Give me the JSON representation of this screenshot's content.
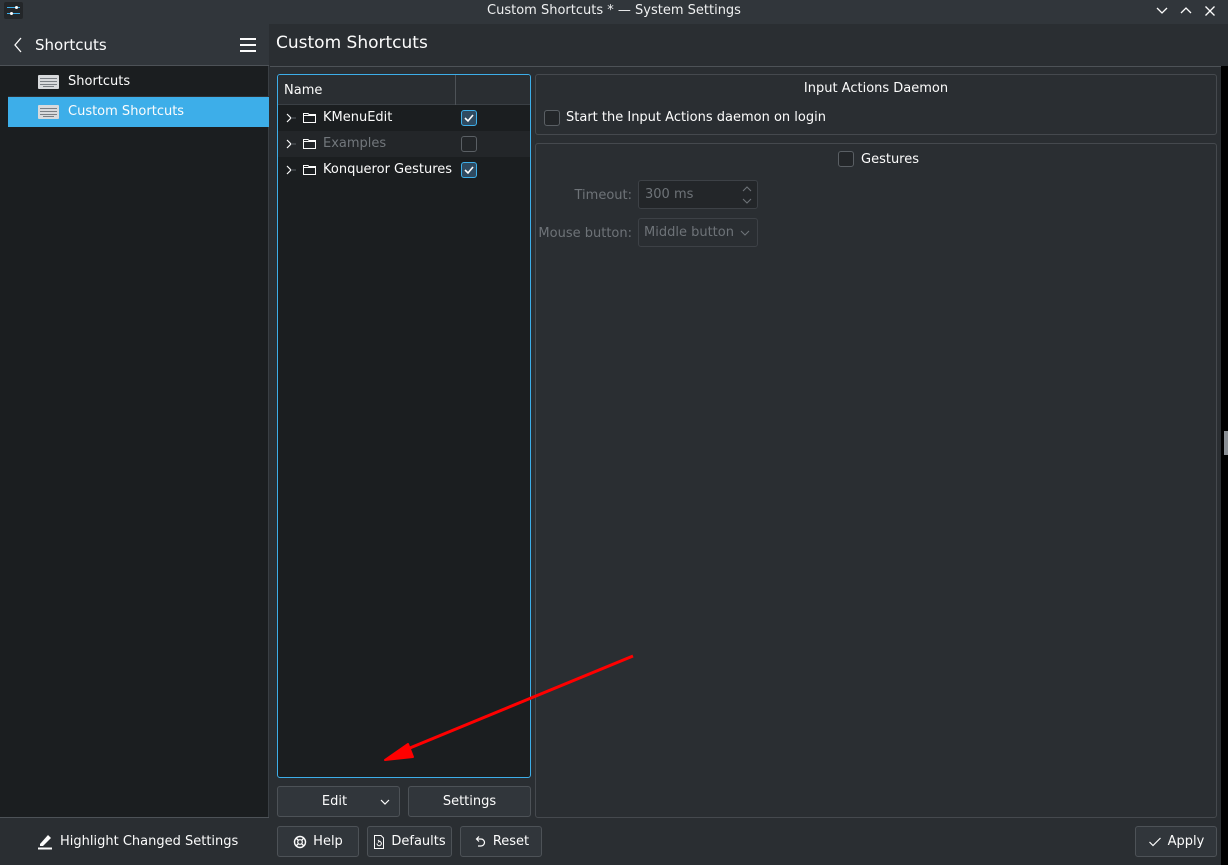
{
  "window": {
    "title": "Custom Shortcuts * — System Settings",
    "controls": [
      "minimize",
      "maximize",
      "close"
    ]
  },
  "sidebar": {
    "header": "Shortcuts",
    "items": [
      {
        "label": "Shortcuts",
        "icon": "keyboard-icon",
        "active": false
      },
      {
        "label": "Custom Shortcuts",
        "icon": "keyboard-icon",
        "active": true
      }
    ],
    "footer_button": "Highlight Changed Settings"
  },
  "page": {
    "title": "Custom Shortcuts"
  },
  "tree": {
    "columns": [
      "Name",
      ""
    ],
    "rows": [
      {
        "name": "KMenuEdit",
        "checked": true,
        "enabled": true
      },
      {
        "name": "Examples",
        "checked": false,
        "enabled": false
      },
      {
        "name": "Konqueror Gestures",
        "checked": true,
        "enabled": true
      }
    ],
    "edit_button": "Edit",
    "settings_button": "Settings"
  },
  "daemon": {
    "title": "Input Actions Daemon",
    "start_on_login_label": "Start the Input Actions daemon on login",
    "start_on_login_checked": false
  },
  "gestures": {
    "title": "Gestures",
    "checked": false,
    "timeout_label": "Timeout:",
    "timeout_value": "300 ms",
    "mouse_button_label": "Mouse button:",
    "mouse_button_value": "Middle button"
  },
  "footer": {
    "help": "Help",
    "defaults": "Defaults",
    "reset": "Reset",
    "apply": "Apply"
  },
  "annotation": {
    "color": "#ff0000",
    "type": "arrow"
  },
  "colors": {
    "accent": "#3daee9",
    "background": "#2a2e32",
    "view_background": "#1b1e20"
  }
}
